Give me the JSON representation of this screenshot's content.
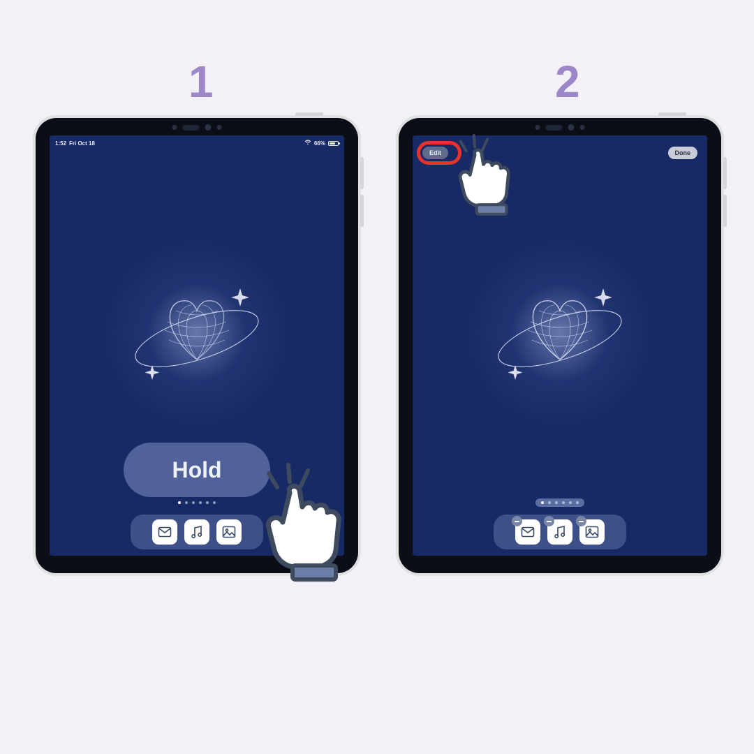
{
  "steps": {
    "one": "1",
    "two": "2"
  },
  "hold_label": "Hold",
  "buttons": {
    "edit": "Edit",
    "done": "Done"
  },
  "status": {
    "time": "1:52",
    "date": "Fri Oct 18",
    "battery_pct": "66%"
  },
  "dock_icons": [
    "mail-icon",
    "music-icon",
    "photos-icon"
  ],
  "page_dot_count": 6,
  "colors": {
    "bg": "#f3f1f7",
    "step_label": "#9c87c9",
    "screen": "#182a66",
    "highlight": "#e8332d"
  }
}
